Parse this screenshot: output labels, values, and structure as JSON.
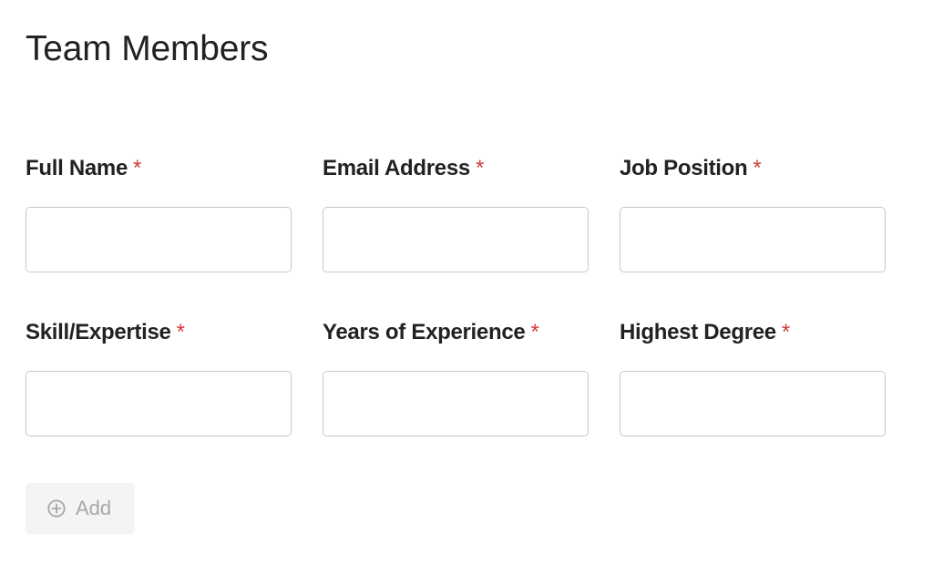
{
  "header": {
    "title": "Team Members"
  },
  "form": {
    "required_marker": "*",
    "fields": [
      {
        "label": "Full Name",
        "value": ""
      },
      {
        "label": "Email Address",
        "value": ""
      },
      {
        "label": "Job Position",
        "value": ""
      },
      {
        "label": "Skill/Expertise",
        "value": ""
      },
      {
        "label": "Years of Experience",
        "value": ""
      },
      {
        "label": "Highest Degree",
        "value": ""
      }
    ]
  },
  "actions": {
    "add_label": "Add",
    "add_icon": "plus-circle-icon"
  },
  "colors": {
    "required": "#d23c36",
    "input_border": "#c8c8c8",
    "button_background": "#f4f4f4",
    "button_text": "#a8a8a8"
  }
}
